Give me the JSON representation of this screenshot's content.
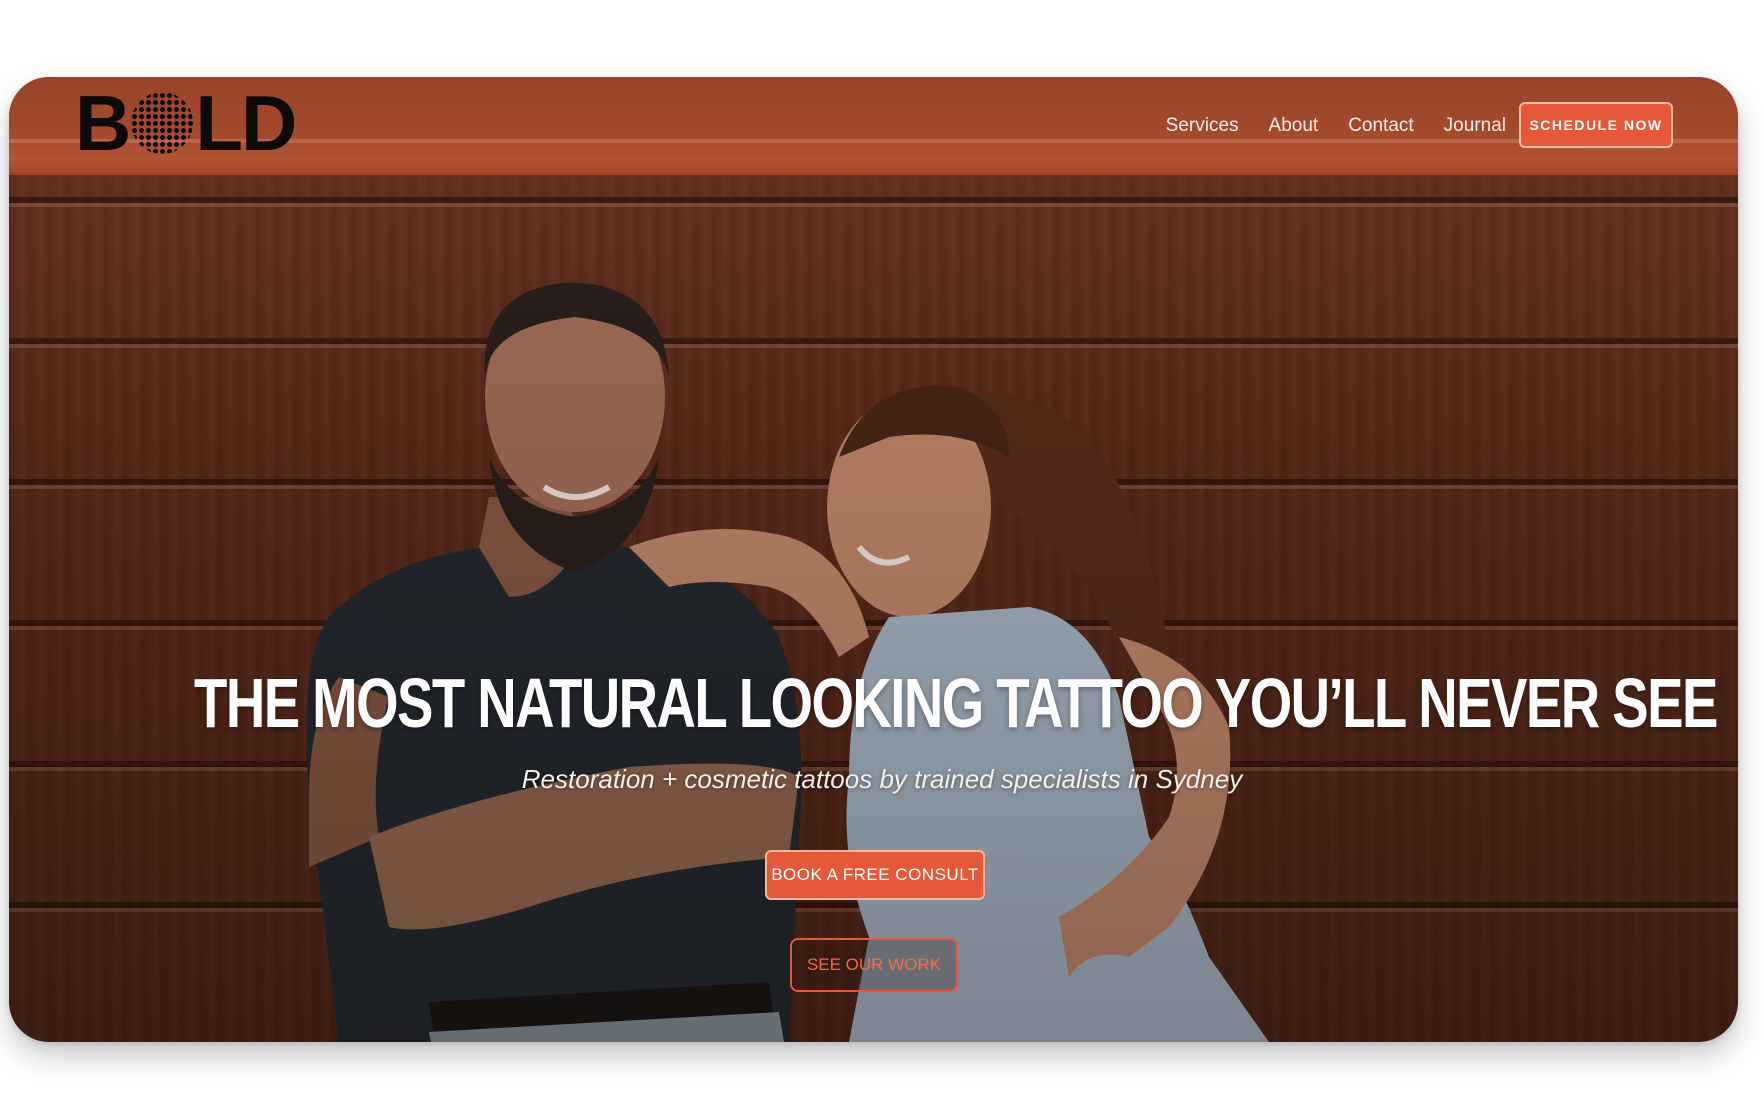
{
  "brand": {
    "logo_text_left": "B",
    "logo_text_right": "LD",
    "accent_color": "#e5593a"
  },
  "nav": {
    "items": [
      {
        "label": "Services"
      },
      {
        "label": "About"
      },
      {
        "label": "Contact"
      },
      {
        "label": "Journal"
      }
    ],
    "cta_label": "SCHEDULE NOW"
  },
  "hero": {
    "title": "THE MOST NATURAL LOOKING TATTOO YOU’LL NEVER SEE",
    "subtitle": "Restoration + cosmetic tattoos by trained specialists in Sydney",
    "primary_button": "BOOK A FREE CONSULT",
    "secondary_button": "SEE OUR WORK"
  }
}
